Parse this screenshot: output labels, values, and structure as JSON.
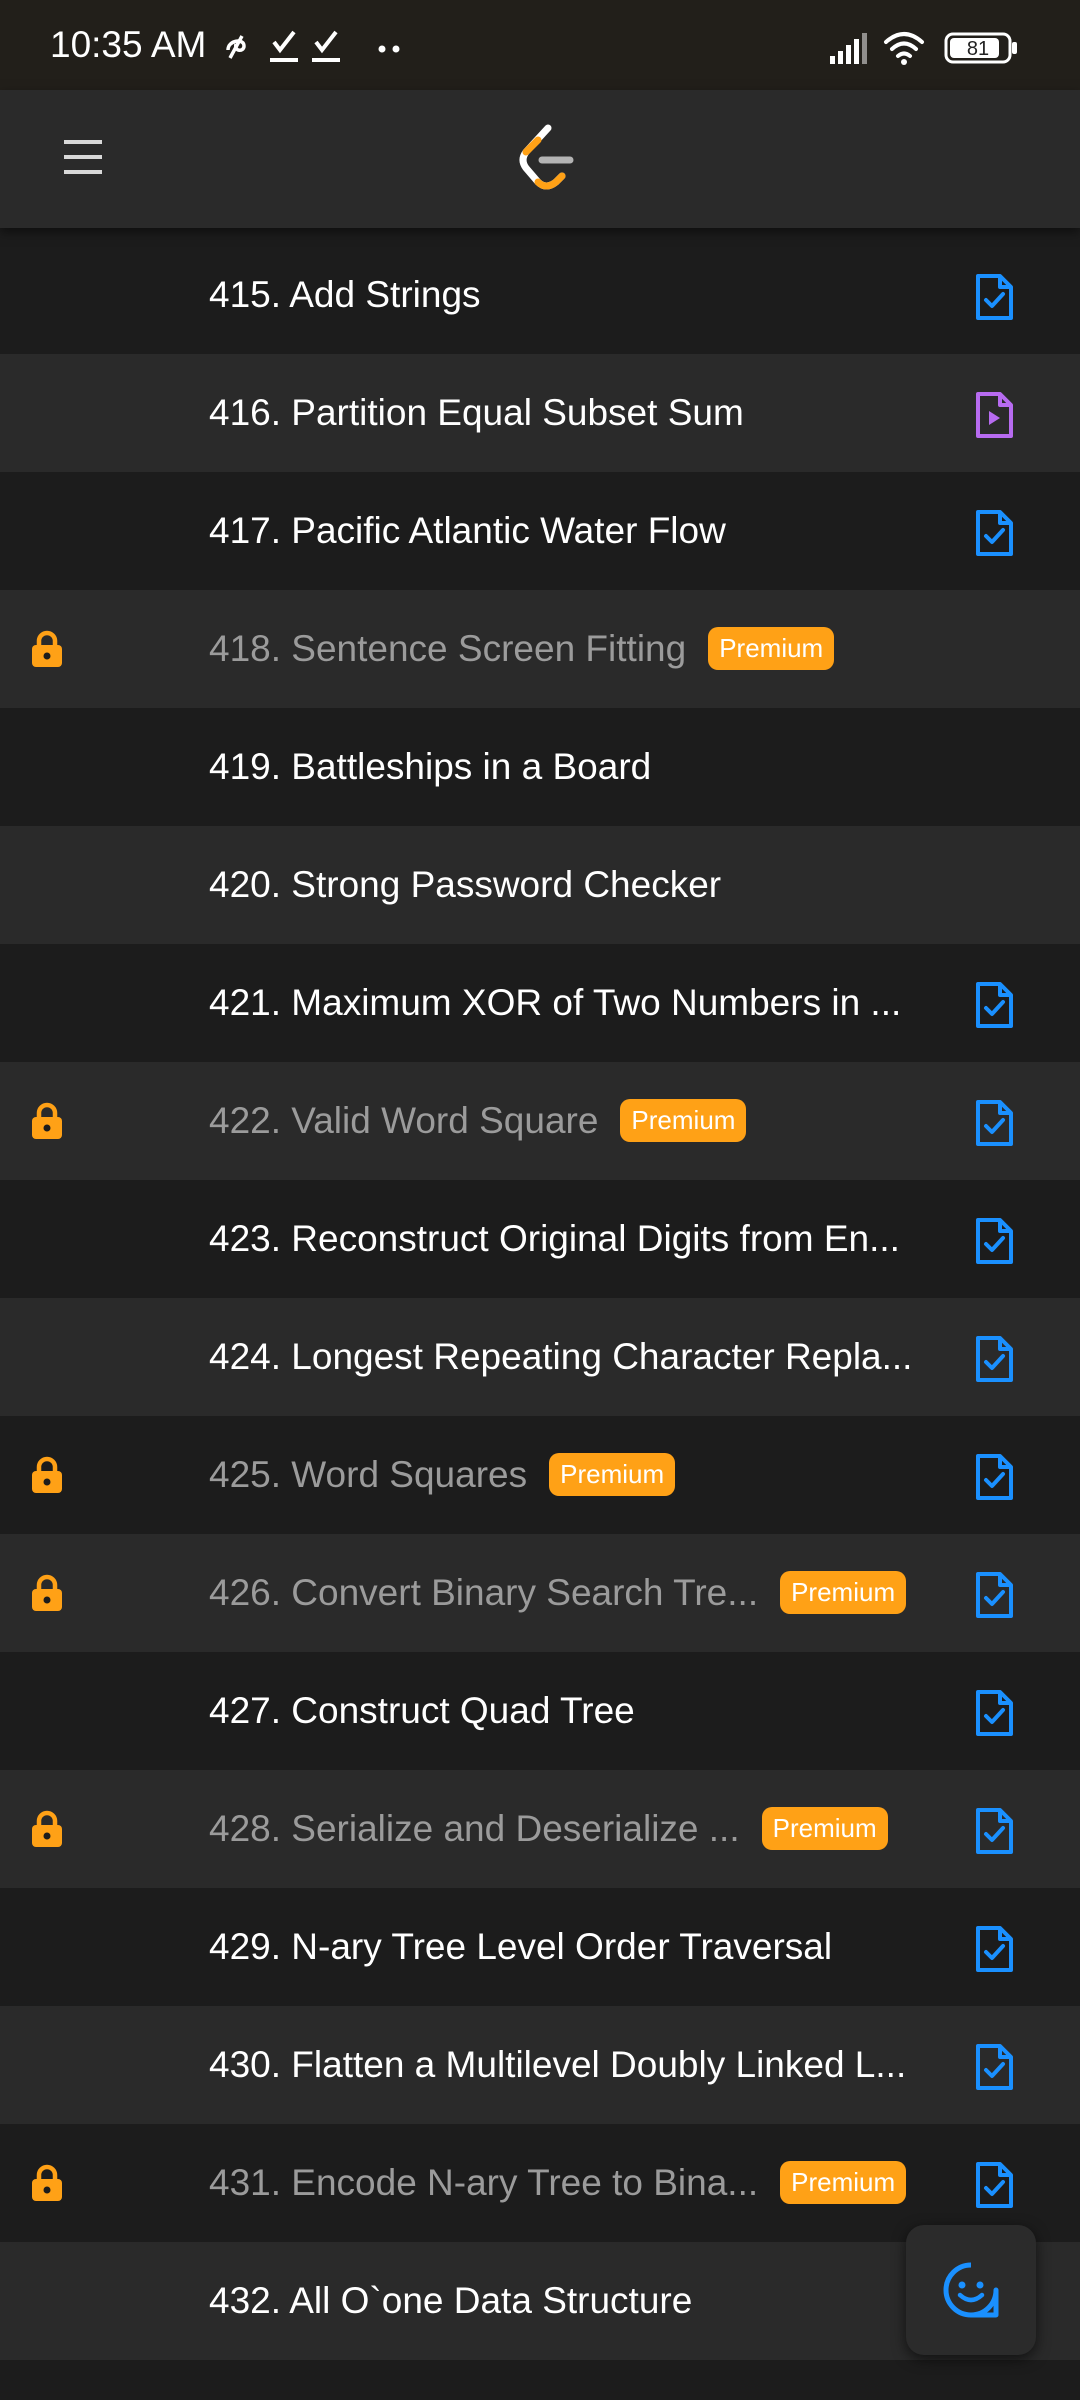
{
  "status_bar": {
    "time": "10:35 AM",
    "battery": "81",
    "icons": [
      "notification-icon",
      "check-icon",
      "check-icon",
      "more-dots-icon",
      "signal-icon",
      "wifi-icon",
      "battery-icon"
    ]
  },
  "app_bar": {
    "menu_icon": "hamburger-menu-icon",
    "logo_icon": "leetcode-logo-icon"
  },
  "colors": {
    "premium": "#ffa116",
    "solution_blue": "#1a90ff",
    "video_purple": "#b76bf0",
    "row_dark": "#1c1c1c",
    "row_light": "#2a2a2a"
  },
  "premium_label": "Premium",
  "problems": [
    {
      "title": "415. Add Strings",
      "locked": false,
      "premium": false,
      "solution": "article"
    },
    {
      "title": "416. Partition Equal Subset Sum",
      "locked": false,
      "premium": false,
      "solution": "video"
    },
    {
      "title": "417. Pacific Atlantic Water Flow",
      "locked": false,
      "premium": false,
      "solution": "article"
    },
    {
      "title": "418. Sentence Screen Fitting",
      "locked": true,
      "premium": true,
      "solution": "none"
    },
    {
      "title": "419. Battleships in a Board",
      "locked": false,
      "premium": false,
      "solution": "none"
    },
    {
      "title": "420. Strong Password Checker",
      "locked": false,
      "premium": false,
      "solution": "none"
    },
    {
      "title": "421. Maximum XOR of Two Numbers in ...",
      "locked": false,
      "premium": false,
      "solution": "article"
    },
    {
      "title": "422. Valid Word Square",
      "locked": true,
      "premium": true,
      "solution": "article"
    },
    {
      "title": "423. Reconstruct Original Digits from En...",
      "locked": false,
      "premium": false,
      "solution": "article"
    },
    {
      "title": "424. Longest Repeating Character Repla...",
      "locked": false,
      "premium": false,
      "solution": "article"
    },
    {
      "title": "425. Word Squares",
      "locked": true,
      "premium": true,
      "solution": "article"
    },
    {
      "title": "426. Convert Binary Search Tre...",
      "locked": true,
      "premium": true,
      "solution": "article"
    },
    {
      "title": "427. Construct Quad Tree",
      "locked": false,
      "premium": false,
      "solution": "article"
    },
    {
      "title": "428. Serialize and Deserialize ...",
      "locked": true,
      "premium": true,
      "solution": "article"
    },
    {
      "title": "429. N-ary Tree Level Order Traversal",
      "locked": false,
      "premium": false,
      "solution": "article"
    },
    {
      "title": "430. Flatten a Multilevel Doubly Linked L...",
      "locked": false,
      "premium": false,
      "solution": "article"
    },
    {
      "title": "431. Encode N-ary Tree to Bina...",
      "locked": true,
      "premium": true,
      "solution": "article"
    },
    {
      "title": "432. All O`one Data Structure",
      "locked": false,
      "premium": false,
      "solution": "none"
    }
  ],
  "fab": {
    "icon": "feedback-smiley-icon"
  }
}
